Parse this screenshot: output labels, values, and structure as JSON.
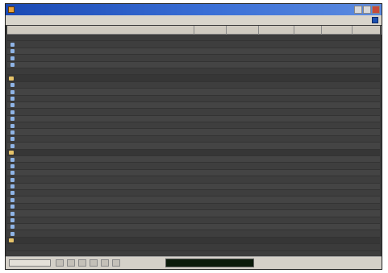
{
  "window": {
    "title": ""
  },
  "menu": {
    "items": [
      "",
      "",
      "",
      "",
      "",
      ""
    ]
  },
  "columns": [
    "",
    "",
    "",
    "",
    "",
    "",
    ""
  ],
  "rows": [
    {
      "kind": "blank"
    },
    {
      "kind": "data"
    },
    {
      "kind": "data"
    },
    {
      "kind": "data"
    },
    {
      "kind": "data"
    },
    {
      "kind": "blank"
    },
    {
      "kind": "group"
    },
    {
      "kind": "data"
    },
    {
      "kind": "data"
    },
    {
      "kind": "data"
    },
    {
      "kind": "data"
    },
    {
      "kind": "data"
    },
    {
      "kind": "data"
    },
    {
      "kind": "data"
    },
    {
      "kind": "data"
    },
    {
      "kind": "data"
    },
    {
      "kind": "data"
    },
    {
      "kind": "group"
    },
    {
      "kind": "data"
    },
    {
      "kind": "data",
      "selected": true
    },
    {
      "kind": "data"
    },
    {
      "kind": "data"
    },
    {
      "kind": "data"
    },
    {
      "kind": "data"
    },
    {
      "kind": "data"
    },
    {
      "kind": "data"
    },
    {
      "kind": "data"
    },
    {
      "kind": "data"
    },
    {
      "kind": "data"
    },
    {
      "kind": "data"
    },
    {
      "kind": "group"
    },
    {
      "kind": "blank"
    }
  ],
  "status": {
    "left_text": "",
    "log_text": ""
  }
}
